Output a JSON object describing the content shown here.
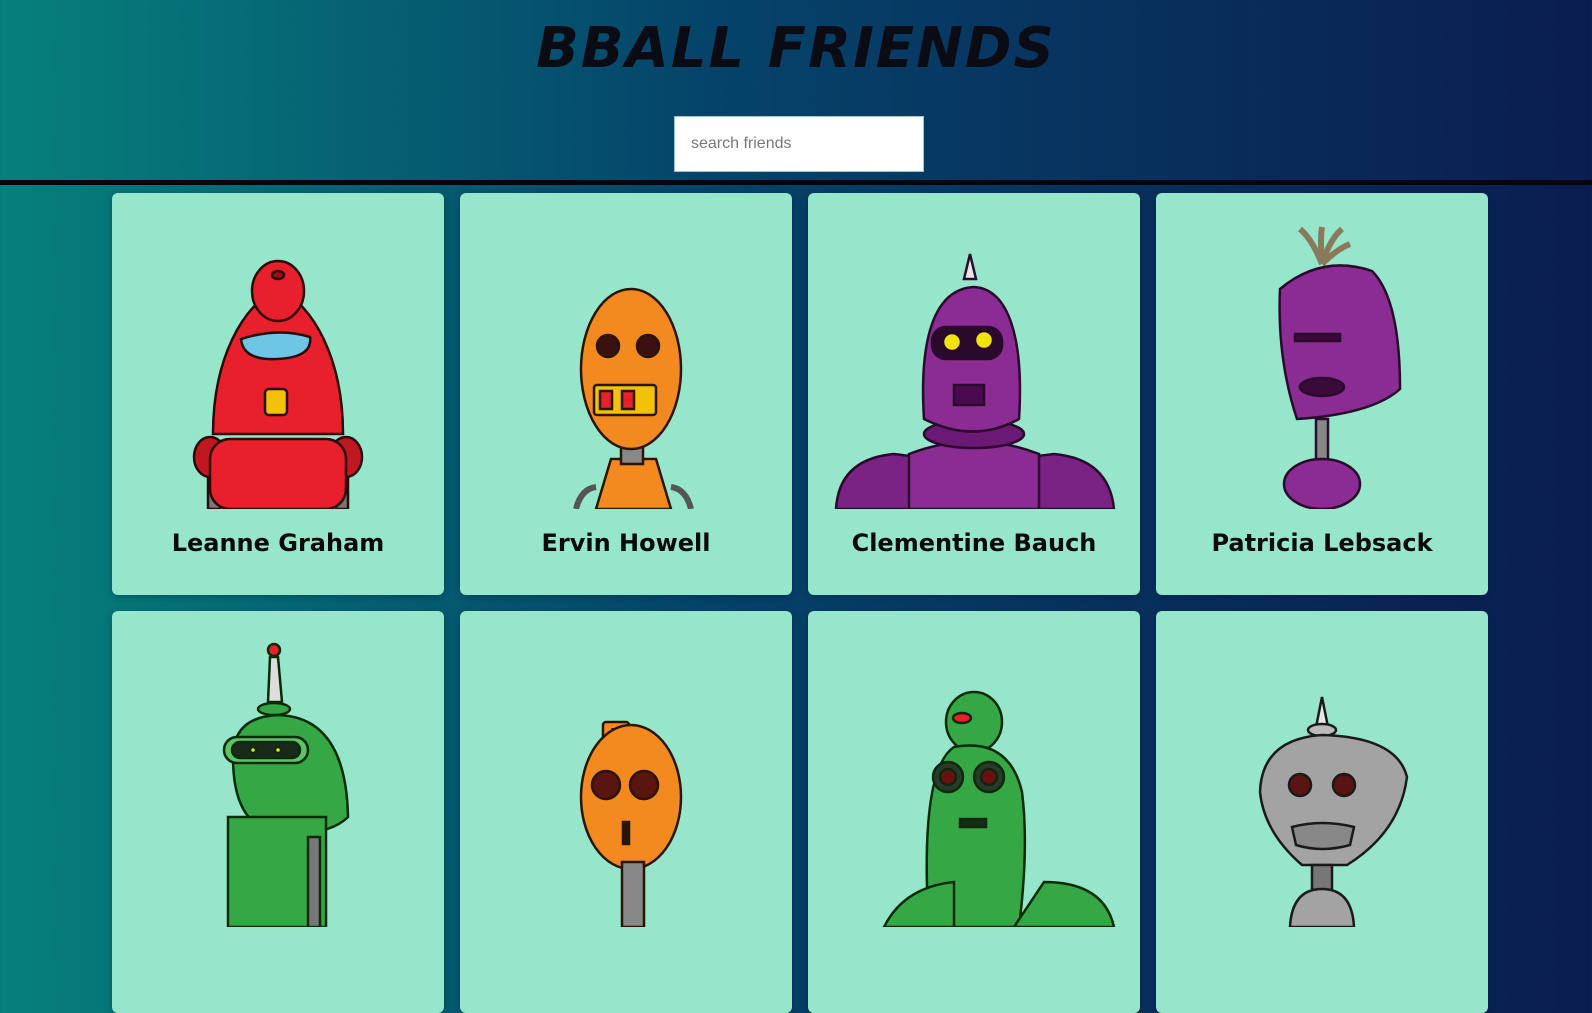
{
  "header": {
    "title": "BBALL FRIENDS",
    "search_placeholder": "search friends"
  },
  "friends": [
    {
      "name": "Leanne Graham",
      "color": "#e8202b",
      "robot": "red-dome-robot"
    },
    {
      "name": "Ervin Howell",
      "color": "#f28a20",
      "robot": "orange-oval-robot"
    },
    {
      "name": "Clementine Bauch",
      "color": "#8a2c94",
      "robot": "purple-spike-robot"
    },
    {
      "name": "Patricia Lebsack",
      "color": "#8a2c94",
      "robot": "purple-block-robot"
    },
    {
      "name": "",
      "color": "#35a845",
      "robot": "green-antenna-robot"
    },
    {
      "name": "",
      "color": "#f28a20",
      "robot": "orange-seven-robot"
    },
    {
      "name": "",
      "color": "#35a845",
      "robot": "green-bug-eye-robot"
    },
    {
      "name": "",
      "color": "#a3a3a3",
      "robot": "gray-spike-robot"
    }
  ]
}
